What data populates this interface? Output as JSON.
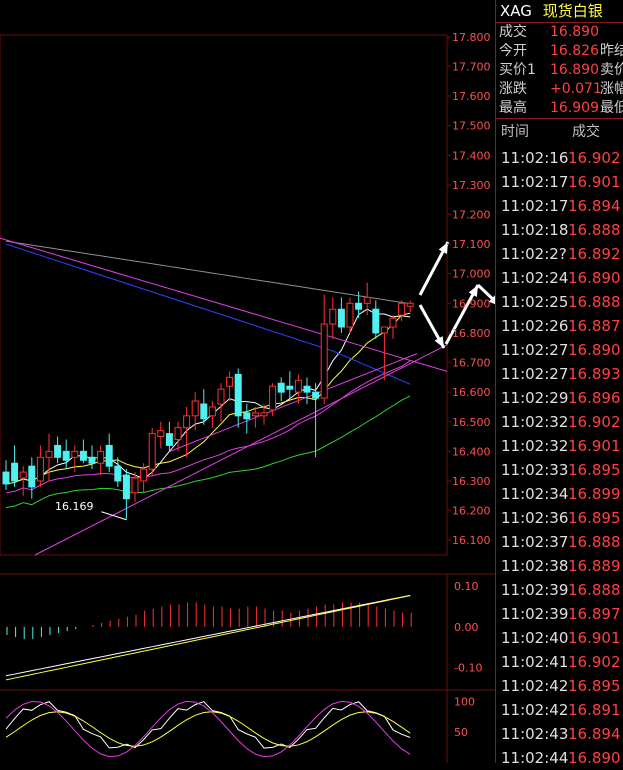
{
  "header": {
    "symbol": "XAG",
    "name": "现货白银"
  },
  "quote": [
    {
      "label": "成交",
      "value": "16.890",
      "label2": ""
    },
    {
      "label": "今开",
      "value": "16.826",
      "label2": "昨结"
    },
    {
      "label": "买价1",
      "value": "16.890",
      "label2": "卖价"
    },
    {
      "label": "涨跌",
      "value": "+0.071",
      "label2": "涨幅"
    },
    {
      "label": "最高",
      "value": "16.909",
      "label2": "最低"
    }
  ],
  "trades_header": {
    "time": "时间",
    "price": "成交"
  },
  "trades": [
    {
      "time": "11:02:16",
      "price": "16.902"
    },
    {
      "time": "11:02:17",
      "price": "16.901"
    },
    {
      "time": "11:02:17",
      "price": "16.894"
    },
    {
      "time": "11:02:18",
      "price": "16.888"
    },
    {
      "time": "11:02:2?",
      "price": "16.892"
    },
    {
      "time": "11:02:24",
      "price": "16.890"
    },
    {
      "time": "11:02:25",
      "price": "16.888"
    },
    {
      "time": "11:02:26",
      "price": "16.887"
    },
    {
      "time": "11:02:27",
      "price": "16.890"
    },
    {
      "time": "11:02:27",
      "price": "16.893"
    },
    {
      "time": "11:02:29",
      "price": "16.896"
    },
    {
      "time": "11:02:32",
      "price": "16.902"
    },
    {
      "time": "11:02:32",
      "price": "16.901"
    },
    {
      "time": "11:02:33",
      "price": "16.895"
    },
    {
      "time": "11:02:34",
      "price": "16.899"
    },
    {
      "time": "11:02:36",
      "price": "16.895"
    },
    {
      "time": "11:02:37",
      "price": "16.888"
    },
    {
      "time": "11:02:38",
      "price": "16.889"
    },
    {
      "time": "11:02:39",
      "price": "16.888"
    },
    {
      "time": "11:02:39",
      "price": "16.897"
    },
    {
      "time": "11:02:40",
      "price": "16.901"
    },
    {
      "time": "11:02:41",
      "price": "16.902"
    },
    {
      "time": "11:02:42",
      "price": "16.895"
    },
    {
      "time": "11:02:42",
      "price": "16.891"
    },
    {
      "time": "11:02:43",
      "price": "16.894"
    },
    {
      "time": "11:02:44",
      "price": "16.890"
    }
  ],
  "chart_data": {
    "type": "candlestick",
    "price_axis": {
      "ticks": [
        "17.800",
        "17.700",
        "17.600",
        "17.500",
        "17.400",
        "17.300",
        "17.200",
        "17.100",
        "17.000",
        "16.900",
        "16.800",
        "16.700",
        "16.600",
        "16.500",
        "16.400",
        "16.300",
        "16.200",
        "16.100"
      ],
      "range": [
        16.05,
        17.85
      ]
    },
    "annotation": {
      "text": "16.169",
      "value": 16.169
    },
    "candles": [
      {
        "o": 16.33,
        "h": 16.37,
        "l": 16.27,
        "c": 16.29
      },
      {
        "o": 16.36,
        "h": 16.42,
        "l": 16.28,
        "c": 16.3
      },
      {
        "o": 16.31,
        "h": 16.35,
        "l": 16.25,
        "c": 16.33
      },
      {
        "o": 16.35,
        "h": 16.38,
        "l": 16.24,
        "c": 16.28
      },
      {
        "o": 16.3,
        "h": 16.42,
        "l": 16.28,
        "c": 16.38
      },
      {
        "o": 16.38,
        "h": 16.46,
        "l": 16.3,
        "c": 16.4
      },
      {
        "o": 16.42,
        "h": 16.45,
        "l": 16.36,
        "c": 16.38
      },
      {
        "o": 16.4,
        "h": 16.44,
        "l": 16.34,
        "c": 16.37
      },
      {
        "o": 16.38,
        "h": 16.42,
        "l": 16.33,
        "c": 16.4
      },
      {
        "o": 16.4,
        "h": 16.44,
        "l": 16.36,
        "c": 16.37
      },
      {
        "o": 16.38,
        "h": 16.42,
        "l": 16.34,
        "c": 16.36
      },
      {
        "o": 16.36,
        "h": 16.42,
        "l": 16.32,
        "c": 16.4
      },
      {
        "o": 16.42,
        "h": 16.46,
        "l": 16.33,
        "c": 16.35
      },
      {
        "o": 16.35,
        "h": 16.38,
        "l": 16.28,
        "c": 16.3
      },
      {
        "o": 16.32,
        "h": 16.34,
        "l": 16.17,
        "c": 16.24
      },
      {
        "o": 16.26,
        "h": 16.33,
        "l": 16.23,
        "c": 16.31
      },
      {
        "o": 16.3,
        "h": 16.36,
        "l": 16.26,
        "c": 16.34
      },
      {
        "o": 16.34,
        "h": 16.48,
        "l": 16.32,
        "c": 16.46
      },
      {
        "o": 16.45,
        "h": 16.5,
        "l": 16.41,
        "c": 16.47
      },
      {
        "o": 16.46,
        "h": 16.5,
        "l": 16.4,
        "c": 16.42
      },
      {
        "o": 16.44,
        "h": 16.5,
        "l": 16.4,
        "c": 16.48
      },
      {
        "o": 16.48,
        "h": 16.55,
        "l": 16.38,
        "c": 16.52
      },
      {
        "o": 16.52,
        "h": 16.6,
        "l": 16.47,
        "c": 16.57
      },
      {
        "o": 16.56,
        "h": 16.61,
        "l": 16.49,
        "c": 16.51
      },
      {
        "o": 16.52,
        "h": 16.57,
        "l": 16.48,
        "c": 16.55
      },
      {
        "o": 16.56,
        "h": 16.63,
        "l": 16.5,
        "c": 16.61
      },
      {
        "o": 16.62,
        "h": 16.67,
        "l": 16.57,
        "c": 16.65
      },
      {
        "o": 16.66,
        "h": 16.68,
        "l": 16.48,
        "c": 16.52
      },
      {
        "o": 16.53,
        "h": 16.56,
        "l": 16.46,
        "c": 16.51
      },
      {
        "o": 16.52,
        "h": 16.55,
        "l": 16.48,
        "c": 16.53
      },
      {
        "o": 16.52,
        "h": 16.56,
        "l": 16.49,
        "c": 16.53
      },
      {
        "o": 16.54,
        "h": 16.63,
        "l": 16.52,
        "c": 16.62
      },
      {
        "o": 16.63,
        "h": 16.65,
        "l": 16.57,
        "c": 16.6
      },
      {
        "o": 16.62,
        "h": 16.67,
        "l": 16.58,
        "c": 16.61
      },
      {
        "o": 16.6,
        "h": 16.66,
        "l": 16.56,
        "c": 16.64
      },
      {
        "o": 16.62,
        "h": 16.65,
        "l": 16.56,
        "c": 16.6
      },
      {
        "o": 16.6,
        "h": 16.63,
        "l": 16.38,
        "c": 16.58
      },
      {
        "o": 16.58,
        "h": 16.93,
        "l": 16.56,
        "c": 16.83
      },
      {
        "o": 16.83,
        "h": 16.92,
        "l": 16.78,
        "c": 16.88
      },
      {
        "o": 16.88,
        "h": 16.92,
        "l": 16.8,
        "c": 16.82
      },
      {
        "o": 16.82,
        "h": 16.92,
        "l": 16.8,
        "c": 16.9
      },
      {
        "o": 16.9,
        "h": 16.94,
        "l": 16.85,
        "c": 16.88
      },
      {
        "o": 16.9,
        "h": 16.97,
        "l": 16.86,
        "c": 16.92
      },
      {
        "o": 16.88,
        "h": 16.91,
        "l": 16.78,
        "c": 16.8
      },
      {
        "o": 16.8,
        "h": 16.82,
        "l": 16.64,
        "c": 16.82
      },
      {
        "o": 16.82,
        "h": 16.86,
        "l": 16.78,
        "c": 16.85
      },
      {
        "o": 16.86,
        "h": 16.91,
        "l": 16.84,
        "c": 16.9
      },
      {
        "o": 16.89,
        "h": 16.91,
        "l": 16.87,
        "c": 16.9
      }
    ],
    "macd_axis": {
      "ticks": [
        "0.10",
        "0.00",
        "-0.10"
      ],
      "range": [
        -0.15,
        0.12
      ]
    },
    "macd_hist": [
      -0.02,
      -0.025,
      -0.03,
      -0.03,
      -0.025,
      -0.02,
      -0.015,
      -0.01,
      -0.005,
      0.0,
      0.005,
      0.01,
      0.015,
      0.02,
      0.025,
      0.03,
      0.04,
      0.045,
      0.05,
      0.055,
      0.055,
      0.06,
      0.06,
      0.055,
      0.05,
      0.05,
      0.045,
      0.045,
      0.05,
      0.05,
      0.045,
      0.04,
      0.04,
      0.035,
      0.04,
      0.045,
      0.05,
      0.055,
      0.055,
      0.06,
      0.06,
      0.06,
      0.055,
      0.05,
      0.045,
      0.04,
      0.035,
      0.035
    ],
    "kdj_axis": {
      "ticks": [
        "100",
        "50"
      ],
      "range": [
        0,
        115
      ]
    }
  },
  "colors": {
    "up": "#ff3030",
    "down": "#4ef0f0",
    "grid": "#6a1010",
    "ma5": "#ffffff",
    "ma10": "#ffff40",
    "ma20": "#e040e0",
    "ma30": "#30d030",
    "ma60": "#3040ff",
    "ma120": "#909090",
    "trend": "#e040e0",
    "arrow": "#ffffff"
  }
}
